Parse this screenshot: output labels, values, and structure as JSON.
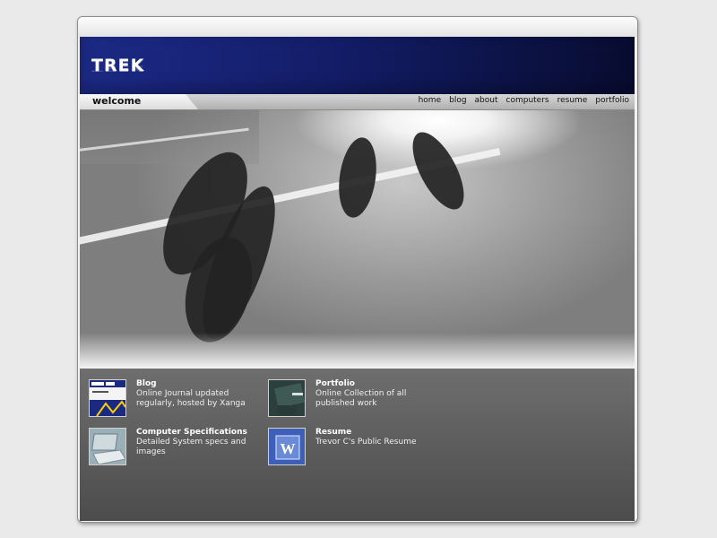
{
  "brand": {
    "logo": "TREK"
  },
  "nav": {
    "current": "welcome",
    "links": [
      "home",
      "blog",
      "about",
      "computers",
      "resume",
      "portfolio"
    ]
  },
  "items": [
    {
      "title": "Blog",
      "desc": "Online Journal updated regularly, hosted by Xanga"
    },
    {
      "title": "Portfolio",
      "desc": "Online Collection of all published work"
    },
    {
      "title": "Computer Specifications",
      "desc": "Detailed System specs and images"
    },
    {
      "title": "Resume",
      "desc": "Trevor C's Public Resume"
    }
  ],
  "colors": {
    "header": "#131d68",
    "lower_panel": "#5a5a5a",
    "accent": "#ffd000"
  }
}
